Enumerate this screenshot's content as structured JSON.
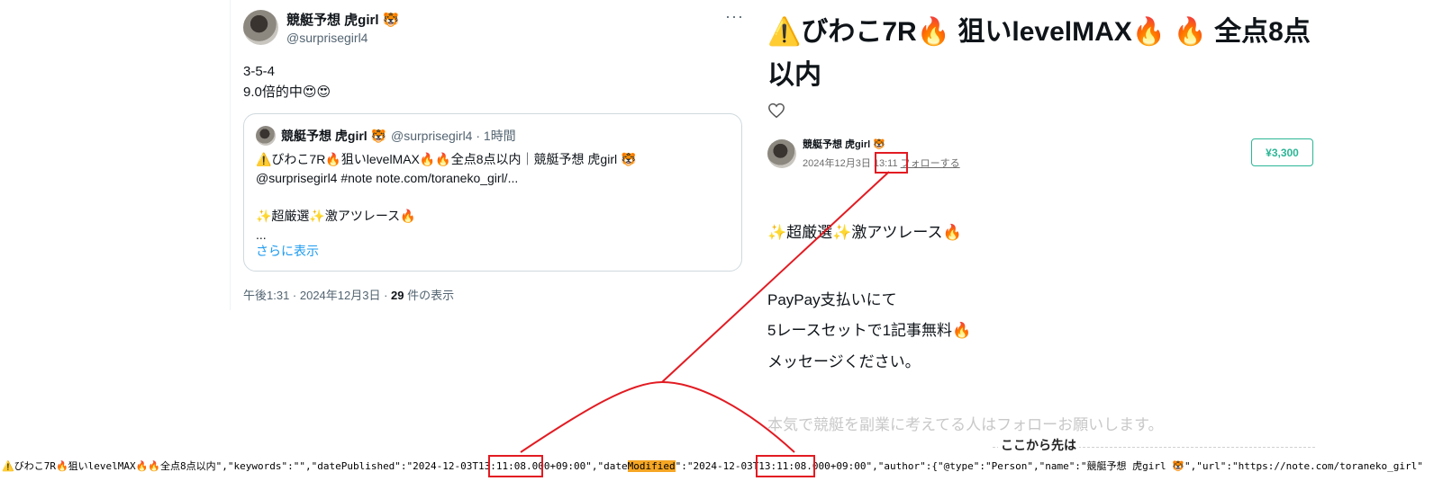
{
  "tweet": {
    "name": "競艇予想 虎girl 🐯",
    "handle": "@surprisegirl4",
    "more": "···",
    "text_line1": "3-5-4",
    "text_line2": "9.0倍的中😍😍",
    "quote": {
      "name": "競艇予想 虎girl 🐯",
      "handle_time": "@surprisegirl4 · 1時間",
      "line1": "⚠️びわこ7R🔥狙いlevelMAX🔥🔥全点8点以内｜競艇予想 虎girl 🐯",
      "line2": "@surprisegirl4 #note note.com/toraneko_girl/...",
      "line3": "✨超厳選✨激アツレース🔥",
      "line4": "...",
      "show_more": "さらに表示"
    },
    "meta_prefix": "午後1:31 · 2024年12月3日 · ",
    "views_count": "29",
    "views_suffix": " 件の表示"
  },
  "note": {
    "title": "⚠️びわこ7R🔥 狙いlevelMAX🔥 🔥 全点8点以内",
    "author_name": "競艇予想 虎girl 🐯",
    "date": "2024年12月3日",
    "time": "13:11",
    "follow": "フォローする",
    "price": "¥3,300",
    "body": [
      "✨超厳選✨激アツレース🔥",
      "PayPay支払いにて",
      "5レースセットで1記事無料🔥",
      "メッセージください。",
      "本気で競艇を副業に考えてる人はフォローお願いします。"
    ],
    "cut_text": "ここから先は"
  },
  "code": {
    "part1": "⚠️びわこ7R🔥狙いlevelMAX🔥🔥全点8点以内\",\"keywords\":\"\",\"datePublished\":\"2024-12-03",
    "published_time": "T13:11:08",
    "part2": ".000+09:00\",\"date",
    "modified_word": "Modified",
    "part3": "\":\"2024-12-03",
    "modified_time": "T13:11:08",
    "part4": ".000+09:00\",\"author\":{\"@type\":\"Person\",\"name\":\"競艇予想 虎girl 🐯\",\"url\":\"https://note.com/toraneko_girl\""
  },
  "colors": {
    "annotation": "#e21b22",
    "highlight": "#f5a623",
    "note_green": "#2cb696",
    "link_blue": "#1d9bf0"
  },
  "icons": {
    "heart": "heart-icon",
    "more": "more-icon"
  }
}
